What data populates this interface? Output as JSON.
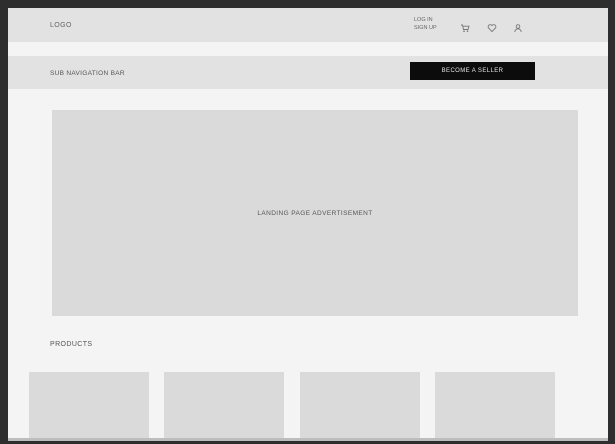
{
  "header": {
    "logo": "LOGO",
    "login_line1": "LOG IN",
    "login_line2": "SIGN UP",
    "icons": [
      "cart-icon",
      "heart-icon",
      "user-icon"
    ]
  },
  "subnav": {
    "label": "SUB NAVIGATION BAR",
    "cta_label": "BECOME A SELLER"
  },
  "hero": {
    "label": "LANDING PAGE ADVERTISEMENT"
  },
  "products": {
    "heading": "PRODUCTS",
    "items": [
      {
        "name": "product-card-1"
      },
      {
        "name": "product-card-2"
      },
      {
        "name": "product-card-3"
      },
      {
        "name": "product-card-4"
      }
    ]
  },
  "colors": {
    "page_bg": "#f4f4f4",
    "bar_bg": "#e2e2e2",
    "placeholder_bg": "#dadada",
    "button_bg": "#0c0c0c",
    "button_text": "#e6e6e6"
  }
}
